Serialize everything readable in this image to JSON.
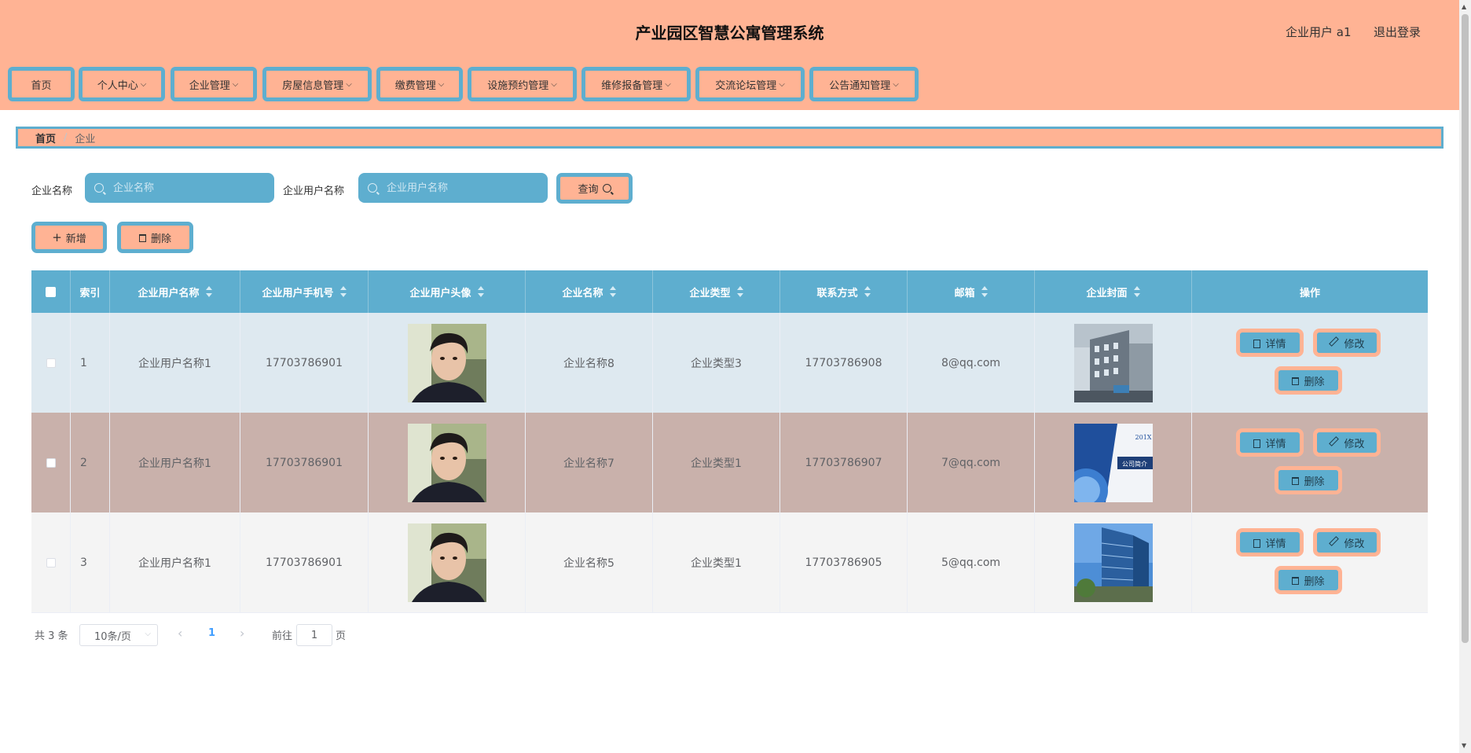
{
  "header": {
    "title": "产业园区智慧公寓管理系统",
    "user_label": "企业用户 a1",
    "logout": "退出登录"
  },
  "menu": [
    {
      "label": "首页"
    },
    {
      "label": "个人中心"
    },
    {
      "label": "企业管理"
    },
    {
      "label": "房屋信息管理"
    },
    {
      "label": "缴费管理"
    },
    {
      "label": "设施预约管理"
    },
    {
      "label": "维修报备管理"
    },
    {
      "label": "交流论坛管理"
    },
    {
      "label": "公告通知管理"
    }
  ],
  "breadcrumb": {
    "home": "首页",
    "separator": "/",
    "current": "企业"
  },
  "search": {
    "company_label": "企业名称",
    "company_placeholder": "企业名称",
    "user_label": "企业用户名称",
    "user_placeholder": "企业用户名称",
    "query_button": "查询"
  },
  "actions": {
    "add": "新增",
    "delete": "删除"
  },
  "table": {
    "headers": [
      "索引",
      "企业用户名称",
      "企业用户手机号",
      "企业用户头像",
      "企业名称",
      "企业类型",
      "联系方式",
      "邮箱",
      "企业封面",
      "操作"
    ],
    "rows": [
      {
        "index": "1",
        "user_name": "企业用户名称1",
        "phone": "17703786901",
        "company": "企业名称8",
        "type": "企业类型3",
        "contact": "17703786908",
        "email": "8@qq.com",
        "cover": "building-photo"
      },
      {
        "index": "2",
        "user_name": "企业用户名称1",
        "phone": "17703786901",
        "company": "企业名称7",
        "type": "企业类型1",
        "contact": "17703786907",
        "email": "7@qq.com",
        "cover": "company-intro-photo",
        "cover_text": "公司简介",
        "cover_year": "201X"
      },
      {
        "index": "3",
        "user_name": "企业用户名称1",
        "phone": "17703786901",
        "company": "企业名称5",
        "type": "企业类型1",
        "contact": "17703786905",
        "email": "5@qq.com",
        "cover": "tower-photo"
      }
    ],
    "row_actions": {
      "detail": "详情",
      "edit": "修改",
      "delete": "删除"
    }
  },
  "pagination": {
    "total": "共 3 条",
    "page_size": "10条/页",
    "current_page": "1",
    "goto_label": "前往",
    "goto_value": "1",
    "page_suffix": "页"
  },
  "colors": {
    "salmon": "#ffb394",
    "blue": "#5eaecf",
    "row1_bg": "#dee9f0",
    "row2_bg": "#c9b1ab",
    "row3_bg": "#f4f4f4"
  }
}
